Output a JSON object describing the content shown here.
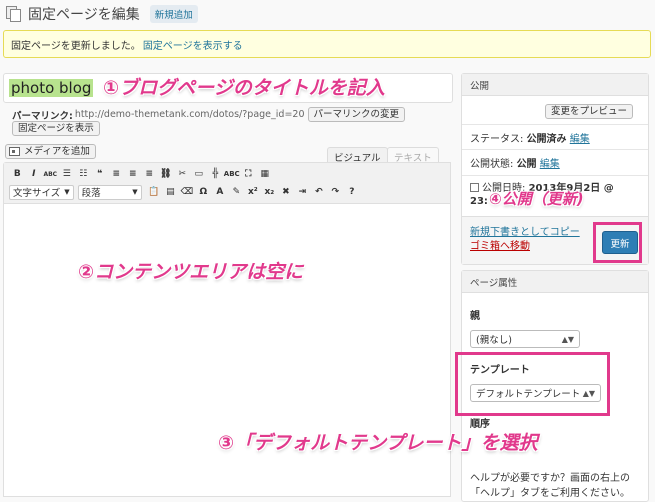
{
  "header": {
    "title": "固定ページを編集",
    "add_new": "新規追加"
  },
  "notice": {
    "message": "固定ページを更新しました。",
    "link": "固定ページを表示する"
  },
  "editor": {
    "title_value": "photo blog",
    "permalink_label": "パーマリンク:",
    "permalink_url": "http://demo-themetank.com/dotos/?page_id=20",
    "change_permalink": "パーマリンクの変更",
    "view_page": "固定ページを表示",
    "add_media": "メディアを追加",
    "tab_visual": "ビジュアル",
    "tab_text": "テキスト",
    "font_size": "文字サイズ",
    "format": "段落"
  },
  "publish": {
    "title": "公開",
    "preview": "変更をプレビュー",
    "status_label": "ステータス:",
    "status_value": "公開済み",
    "visibility_label": "公開状態:",
    "visibility_value": "公開",
    "edit": "編集",
    "date_label": "公開日時:",
    "date_line1": "2013年9月2日 @",
    "date_line2": "23:",
    "copy_draft": "新規下書きとしてコピー",
    "trash": "ゴミ箱へ移動",
    "update": "更新"
  },
  "attributes": {
    "title": "ページ属性",
    "parent_label": "親",
    "parent_value": "(親なし)",
    "template_label": "テンプレート",
    "template_value": "デフォルトテンプレート",
    "order_label": "順序",
    "help_line1": "ヘルプが必要ですか？画面の右上の",
    "help_line2": "「ヘルプ」タブをご利用ください。"
  },
  "annotations": {
    "step1": "①ブログページのタイトルを記入",
    "step2": "②コンテンツエリアは空に",
    "step3": "③「デフォルトテンプレート」を選択",
    "step4": "④公開（更新)",
    "color": "#e1398c"
  }
}
